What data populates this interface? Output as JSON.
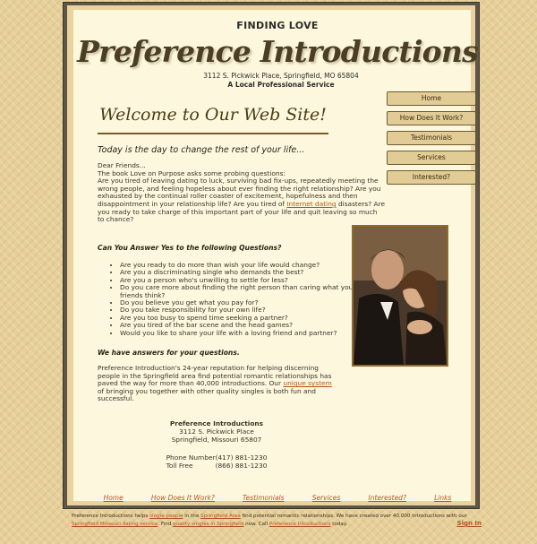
{
  "header": {
    "kicker": "FINDING LOVE",
    "brand": "Preference Introductions",
    "address": "3112 S. Pickwick Place, Springfield, MO 65804",
    "service": "A Local Professional Service"
  },
  "nav": {
    "items": [
      "Home",
      "How Does It Work?",
      "Testimonials",
      "Services",
      "Interested?"
    ]
  },
  "main": {
    "welcome": "Welcome to Our Web Site!",
    "tagline": "Today is the day to change the rest of your life...",
    "greeting": "Dear Friends...",
    "book_line": "The book Love on Purpose asks some probing questions:",
    "intro_before_link": "Are you tired of leaving dating to luck, surviving bad fix-ups, repeatedly meeting the wrong people, and feeling hopeless about ever finding the right relationship? Are you exhausted by the continual roller coaster of excitement, hopefulness and then disappointment in your relationship life? Are you tired of ",
    "intro_link": "Internet dating",
    "intro_after_link": " disasters? Are you ready to take charge of this important part of your life and quit leaving so much to chance?",
    "questions_heading": "Can You Answer Yes to the following Questions?",
    "questions": [
      "Are you ready to do more than wish your life would change?",
      "Are you a discriminating single who demands the best?",
      "Are you a person who's unwilling to settle for less?",
      "Do you care more about finding the right person than caring what your friends think?",
      "Do you believe you get what you pay for?",
      "Do you take responsibility for your own life?",
      "Are you too busy to spend time seeking a partner?",
      "Are you tired of the bar scene and the head games?",
      "Would you like to share your life with a loving friend and partner?"
    ],
    "answers_heading": "We have answers for your questions.",
    "body_before_link": "Preference Introduction's 24-year reputation for helping discerning people in the Springfield area find potential romantic relationships has paved the way for more than 40,000 introductions. Our ",
    "body_link": "unique system",
    "body_after_link": " of bringing you together with other quality singles is both fun and successful."
  },
  "contact": {
    "name": "Preference Introductions",
    "street": "3112 S. Pickwick Place",
    "city": "Springfield, Missouri 65807",
    "phone_label": "Phone Number",
    "phone": "(417) 881-1230",
    "tollfree_label": "Toll Free",
    "tollfree": "(866) 881-1230"
  },
  "footer_nav": {
    "items": [
      "Home",
      "How Does It Work?",
      "Testimonials",
      "Services",
      "Interested?",
      "Links"
    ]
  },
  "bottom": {
    "t1": "Preference Introductions helps ",
    "l1": "single people",
    "t2": " in the ",
    "l2": "Springfield Area",
    "t3": " find potential romantic relationships. We have created over 40,000 introductions with our ",
    "l3": "Springfield Missouri dating service",
    "t4": ". Find ",
    "l4": "quality singles in Springfield",
    "t5": " now. Call ",
    "l5": "Preference Introductions",
    "t6": " today.",
    "sign_in": "Sign In"
  }
}
